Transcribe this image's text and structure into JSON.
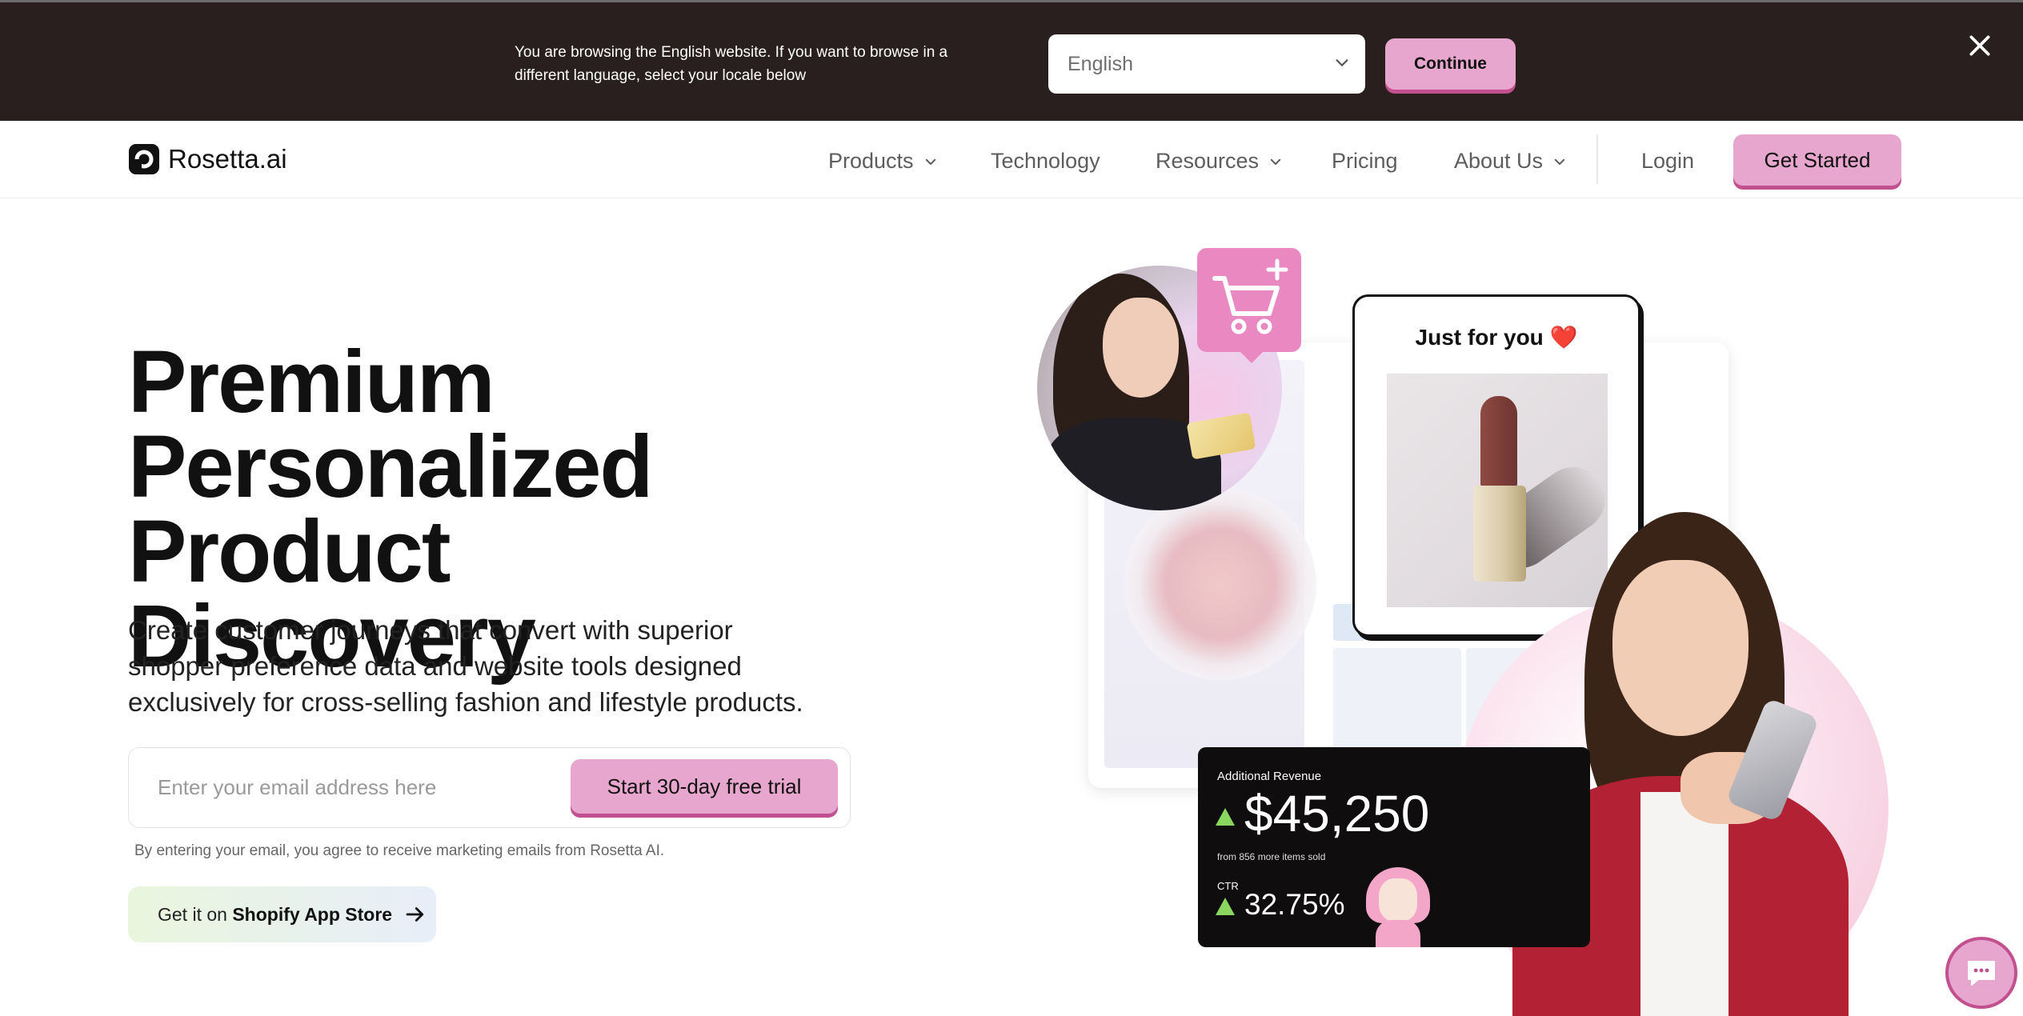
{
  "banner": {
    "message": "You are browsing the English website. If you want to browse in a different language, select your locale below",
    "locale_selected": "English",
    "continue_label": "Continue"
  },
  "nav": {
    "brand": "Rosetta.ai",
    "items": [
      {
        "label": "Products",
        "dropdown": true
      },
      {
        "label": "Technology",
        "dropdown": false
      },
      {
        "label": "Resources",
        "dropdown": true
      },
      {
        "label": "Pricing",
        "dropdown": false
      },
      {
        "label": "About Us",
        "dropdown": true
      }
    ],
    "login_label": "Login",
    "cta_label": "Get Started"
  },
  "hero": {
    "title_line1": "Premium",
    "title_line2": "Personalized",
    "title_line3": "Product Discovery",
    "subtitle": "Create customer journeys that convert with superior shopper preference data and website tools designed exclusively for cross-selling fashion and lifestyle products.",
    "email_placeholder": "Enter your email address here",
    "trial_label": "Start 30-day free trial",
    "disclaimer": "By entering your email, you agree to receive marketing emails from Rosetta AI.",
    "shopify_prefix": "Get it on",
    "shopify_label": "Shopify App Store"
  },
  "illustration": {
    "card_title": "Just for you",
    "heart": "❤️",
    "stats": {
      "revenue_label": "Additional Revenue",
      "revenue_value": "$45,250",
      "revenue_note": "from 856 more items sold",
      "ctr_label": "CTR",
      "ctr_value": "32.75%"
    }
  },
  "colors": {
    "banner_bg": "#2a1f1f",
    "accent_pink": "#e7a6cd",
    "accent_pink_shadow": "#c2508f",
    "up_green": "#8ad65f"
  },
  "icons": {
    "close": "close-icon",
    "select_chevron": "chevron-down-icon",
    "logo": "rosetta-logo-icon",
    "arrow": "arrow-right-icon",
    "cart": "cart-plus-icon",
    "chat": "chat-icon"
  }
}
